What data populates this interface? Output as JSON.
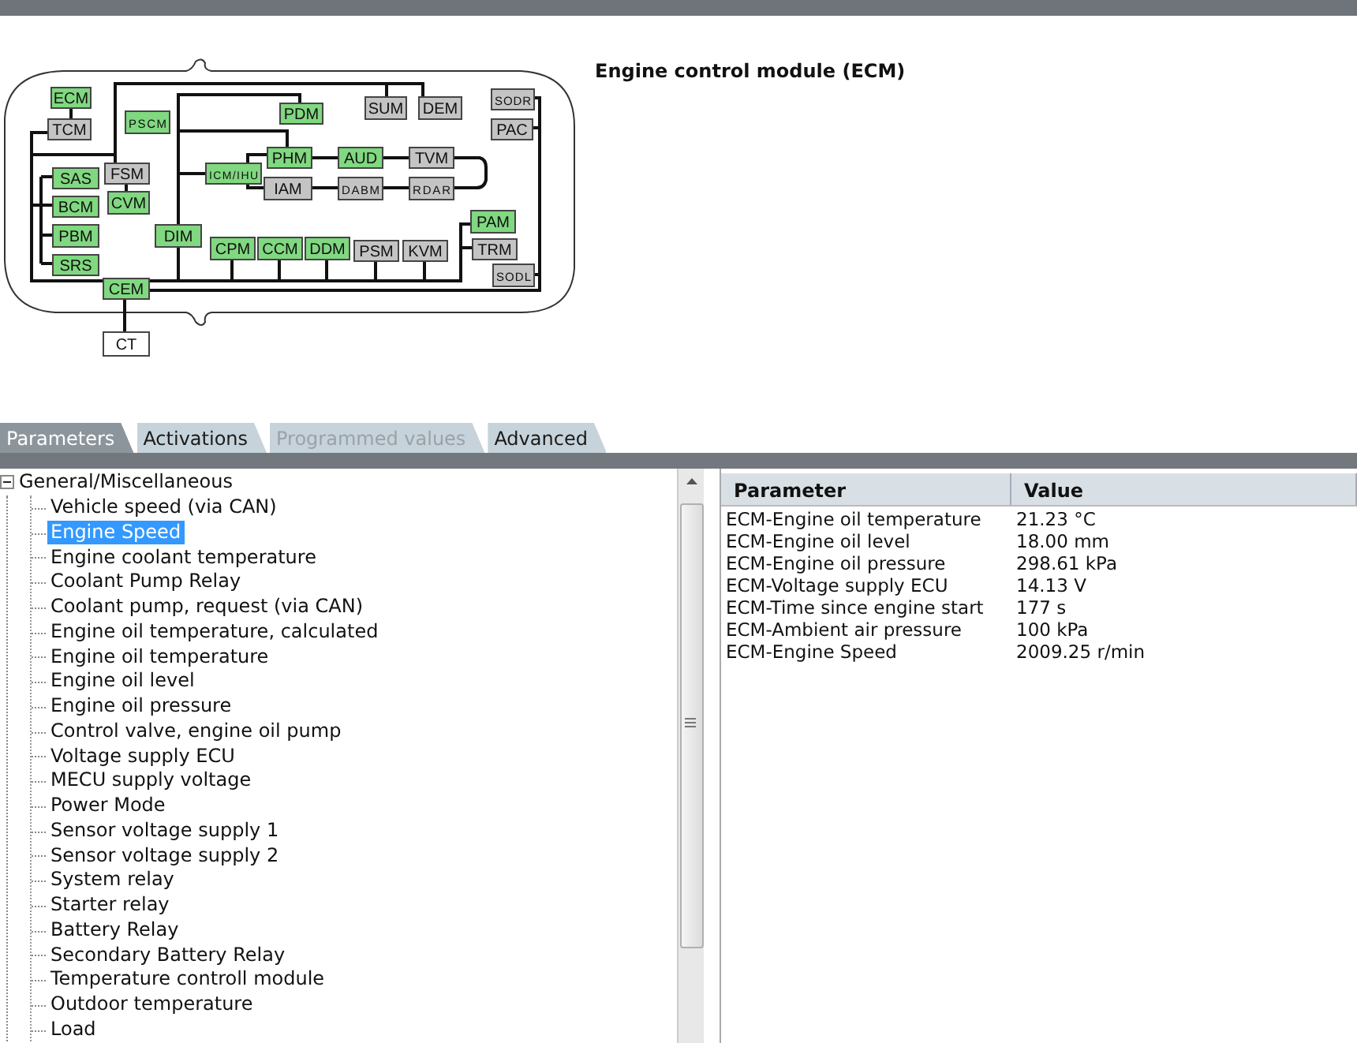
{
  "title": "Engine control module (ECM)",
  "diagram": {
    "modules": [
      {
        "label": "ECM",
        "color": "#80d880"
      },
      {
        "label": "TCM",
        "color": "#c4c4c4"
      },
      {
        "label": "PSCM",
        "color": "#80d880"
      },
      {
        "label": "PDM",
        "color": "#80d880"
      },
      {
        "label": "SUM",
        "color": "#c4c4c4"
      },
      {
        "label": "DEM",
        "color": "#c4c4c4"
      },
      {
        "label": "SODR",
        "color": "#c4c4c4"
      },
      {
        "label": "PAC",
        "color": "#c4c4c4"
      },
      {
        "label": "PHM",
        "color": "#80d880"
      },
      {
        "label": "AUD",
        "color": "#80d880"
      },
      {
        "label": "TVM",
        "color": "#c4c4c4"
      },
      {
        "label": "ICM/IHU",
        "color": "#80d880"
      },
      {
        "label": "IAM",
        "color": "#c4c4c4"
      },
      {
        "label": "DABM",
        "color": "#c4c4c4"
      },
      {
        "label": "RDAR",
        "color": "#c4c4c4"
      },
      {
        "label": "FSM",
        "color": "#c4c4c4"
      },
      {
        "label": "SAS",
        "color": "#80d880"
      },
      {
        "label": "CVM",
        "color": "#80d880"
      },
      {
        "label": "BCM",
        "color": "#80d880"
      },
      {
        "label": "PAM",
        "color": "#80d880"
      },
      {
        "label": "DIM",
        "color": "#80d880"
      },
      {
        "label": "PBM",
        "color": "#80d880"
      },
      {
        "label": "CPM",
        "color": "#80d880"
      },
      {
        "label": "CCM",
        "color": "#80d880"
      },
      {
        "label": "DDM",
        "color": "#80d880"
      },
      {
        "label": "PSM",
        "color": "#c4c4c4"
      },
      {
        "label": "KVM",
        "color": "#c4c4c4"
      },
      {
        "label": "TRM",
        "color": "#c4c4c4"
      },
      {
        "label": "SRS",
        "color": "#80d880"
      },
      {
        "label": "SODL",
        "color": "#c4c4c4"
      },
      {
        "label": "CEM",
        "color": "#80d880"
      },
      {
        "label": "CT",
        "color": "#ffffff"
      }
    ]
  },
  "tabs": [
    {
      "label": "Parameters",
      "selected": true,
      "disabled": false
    },
    {
      "label": "Activations",
      "selected": false,
      "disabled": false
    },
    {
      "label": "Programmed values",
      "selected": false,
      "disabled": true
    },
    {
      "label": "Advanced",
      "selected": false,
      "disabled": false
    }
  ],
  "tree": {
    "label": "General/Miscellaneous",
    "expanded": true,
    "children": [
      {
        "label": "Vehicle speed (via CAN)",
        "selected": false
      },
      {
        "label": "Engine Speed",
        "selected": true
      },
      {
        "label": "Engine coolant temperature",
        "selected": false
      },
      {
        "label": "Coolant Pump Relay",
        "selected": false
      },
      {
        "label": "Coolant pump, request (via CAN)",
        "selected": false
      },
      {
        "label": "Engine oil temperature, calculated",
        "selected": false
      },
      {
        "label": "Engine oil temperature",
        "selected": false
      },
      {
        "label": "Engine oil level",
        "selected": false
      },
      {
        "label": "Engine oil pressure",
        "selected": false
      },
      {
        "label": "Control valve, engine oil pump",
        "selected": false
      },
      {
        "label": "Voltage supply ECU",
        "selected": false
      },
      {
        "label": "MECU supply voltage",
        "selected": false
      },
      {
        "label": "Power Mode",
        "selected": false
      },
      {
        "label": "Sensor voltage supply 1",
        "selected": false
      },
      {
        "label": "Sensor voltage supply 2",
        "selected": false
      },
      {
        "label": "System relay",
        "selected": false
      },
      {
        "label": "Starter relay",
        "selected": false
      },
      {
        "label": "Battery Relay",
        "selected": false
      },
      {
        "label": "Secondary Battery Relay",
        "selected": false
      },
      {
        "label": "Temperature controll module",
        "selected": false
      },
      {
        "label": "Outdoor temperature",
        "selected": false
      },
      {
        "label": "Load",
        "selected": false
      }
    ]
  },
  "table": {
    "columns": [
      "Parameter",
      "Value"
    ],
    "rows": [
      [
        "ECM-Engine oil temperature",
        "21.23 °C"
      ],
      [
        "ECM-Engine oil level",
        "18.00 mm"
      ],
      [
        "ECM-Engine oil pressure",
        "298.61 kPa"
      ],
      [
        "ECM-Voltage supply ECU",
        "14.13 V"
      ],
      [
        "ECM-Time since engine start",
        "177 s"
      ],
      [
        "ECM-Ambient air pressure",
        "100 kPa"
      ],
      [
        "ECM-Engine Speed",
        "2009.25 r/min"
      ]
    ]
  }
}
